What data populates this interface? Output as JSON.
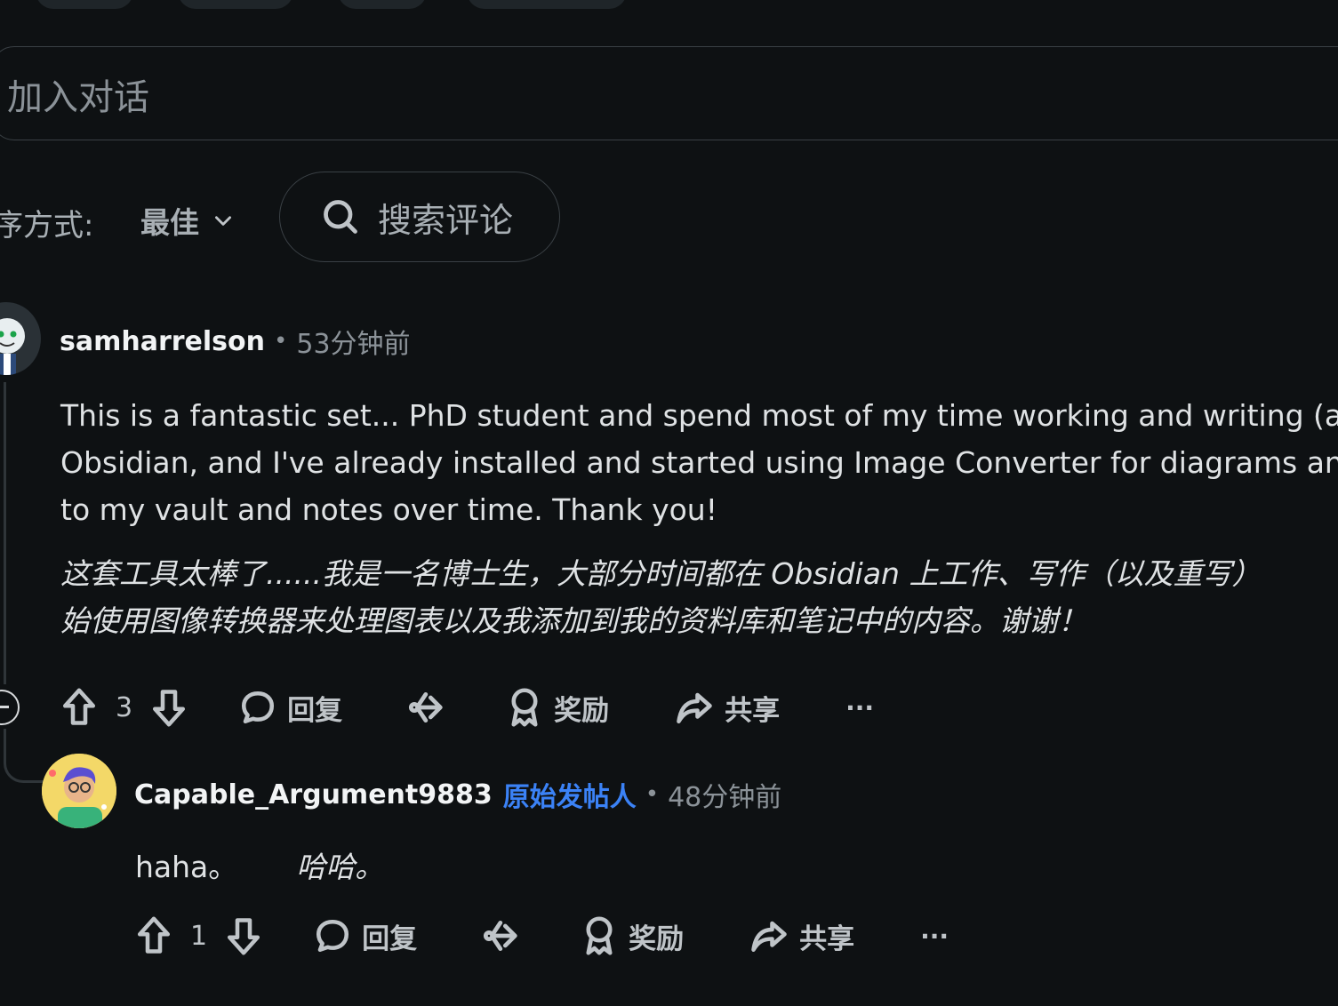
{
  "composer": {
    "placeholder": "加入对话"
  },
  "sort": {
    "label": "序方式:",
    "value": "最佳"
  },
  "search": {
    "label": "搜索评论"
  },
  "comments": [
    {
      "username": "samharrelson",
      "time": "53分钟前",
      "body_lines": [
        "This is a fantastic set... PhD student and spend most of my time working and writing (and",
        "Obsidian, and I've already installed and started using Image Converter for diagrams and t",
        "to my vault and notes over time. Thank you!"
      ],
      "translation_lines": [
        "这套工具太棒了......我是一名博士生，大部分时间都在 Obsidian 上工作、写作（以及重写）",
        "始使用图像转换器来处理图表以及我添加到我的资料库和笔记中的内容。谢谢！"
      ],
      "votes": "3",
      "reply_label": "回复",
      "award_label": "奖励",
      "share_label": "共享",
      "more_label": "···"
    },
    {
      "username": "Capable_Argument9883",
      "op_badge": "原始发帖人",
      "time": "48分钟前",
      "body": "haha。",
      "translation": "哈哈。",
      "votes": "1",
      "reply_label": "回复",
      "award_label": "奖励",
      "share_label": "共享",
      "more_label": "···"
    }
  ],
  "colors": {
    "background": "#0e1113",
    "op_badge": "#3b82f6",
    "text": "#d7dadc",
    "muted": "#8b9298"
  }
}
